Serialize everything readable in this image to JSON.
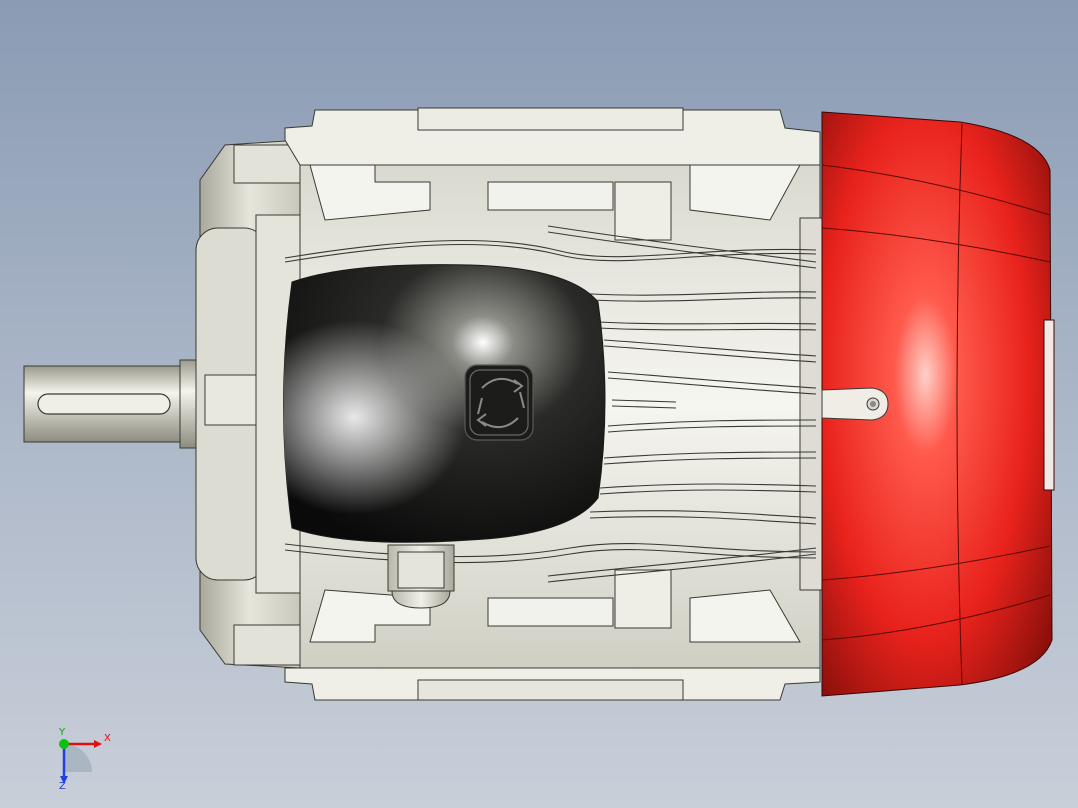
{
  "viewport": {
    "background_top": "#8a9bb3",
    "background_bottom": "#c9cfd9"
  },
  "model": {
    "frame_color": "#ecece6",
    "fan_cover_color": "#e8221c",
    "terminal_box_color": "#151515",
    "icons": [
      "rotation-direction-icon"
    ]
  },
  "triad": {
    "x_label": "X",
    "y_label": "Y",
    "z_label": "Z",
    "x_color": "#e01010",
    "y_color": "#10c010",
    "z_color": "#2040e0"
  }
}
